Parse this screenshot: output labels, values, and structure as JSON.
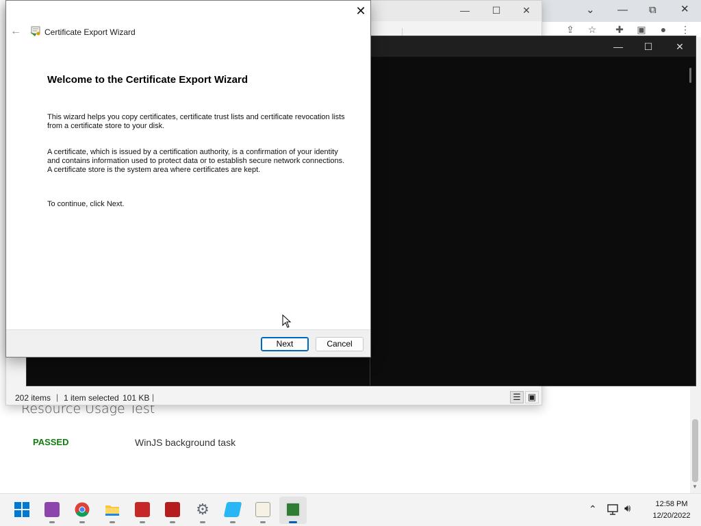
{
  "wizard": {
    "title": "Certificate Export Wizard",
    "heading": "Welcome to the Certificate Export Wizard",
    "paragraph1": "This wizard helps you copy certificates, certificate trust lists and certificate revocation lists from a certificate store to your disk.",
    "paragraph2": "A certificate, which is issued by a certification authority, is a confirmation of your identity and contains information used to protect data or to establish secure network connections. A certificate store is the system area where certificates are kept.",
    "paragraph3": "To continue, click Next.",
    "next_label": "Next",
    "cancel_label": "Cancel"
  },
  "explorer": {
    "item_count": "202 items",
    "selection": "1 item selected",
    "selection_size": "101 KB",
    "separator": "|"
  },
  "browser_page": {
    "section_title": "Resource Usage Test",
    "results": [
      {
        "status": "PASSED",
        "name": "WinJS background task"
      }
    ],
    "colors": {
      "passed": "#107c10"
    }
  },
  "taskbar": {
    "apps": [
      "start-button",
      "app-purple",
      "chrome",
      "file-explorer",
      "app-red-1",
      "app-red-2",
      "settings",
      "app-blue",
      "certificate-manager",
      "app-active"
    ],
    "clock_time": "12:58 PM",
    "clock_date": "12/20/2022"
  }
}
